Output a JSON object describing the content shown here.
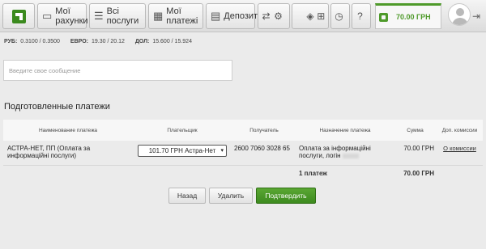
{
  "nav": {
    "items": [
      {
        "label": "Мої рахунки",
        "icon": "wallet-icon"
      },
      {
        "label": "Всі послуги",
        "icon": "list-icon"
      },
      {
        "label": "Мої платежі",
        "icon": "grid-icon"
      },
      {
        "label": "Депозити",
        "icon": "briefcase-icon"
      }
    ],
    "balance": "70.00 ГРН"
  },
  "rates": [
    {
      "currency": "РУБ:",
      "value": "0.3100 / 0.3500"
    },
    {
      "currency": "ЕВРО:",
      "value": "19.30 / 20.12"
    },
    {
      "currency": "ДОЛ:",
      "value": "15.600 / 15.924"
    }
  ],
  "message": {
    "placeholder": "Введите свое сообщение"
  },
  "section_title": "Подготовленные платежи",
  "table": {
    "headers": [
      "Наименование платежа",
      "Плательщик",
      "Получатель",
      "Назначение платежа",
      "Сумма",
      "Доп. комиссии"
    ],
    "rows": [
      {
        "name": "АСТРА-НЕТ, ПП (Оплата за информаційні послуги)",
        "payer": "101.70 ГРН   Астра-Нет",
        "recipient": "2600 7060 3028 65",
        "purpose": "Оплата за інформаційні послуги, логін",
        "amount": "70.00 ГРН",
        "fee": "О комиссии"
      }
    ],
    "footer": {
      "count": "1 платеж",
      "total": "70.00 ГРН"
    }
  },
  "buttons": {
    "back": "Назад",
    "delete": "Удалить",
    "confirm": "Подтвердить"
  }
}
